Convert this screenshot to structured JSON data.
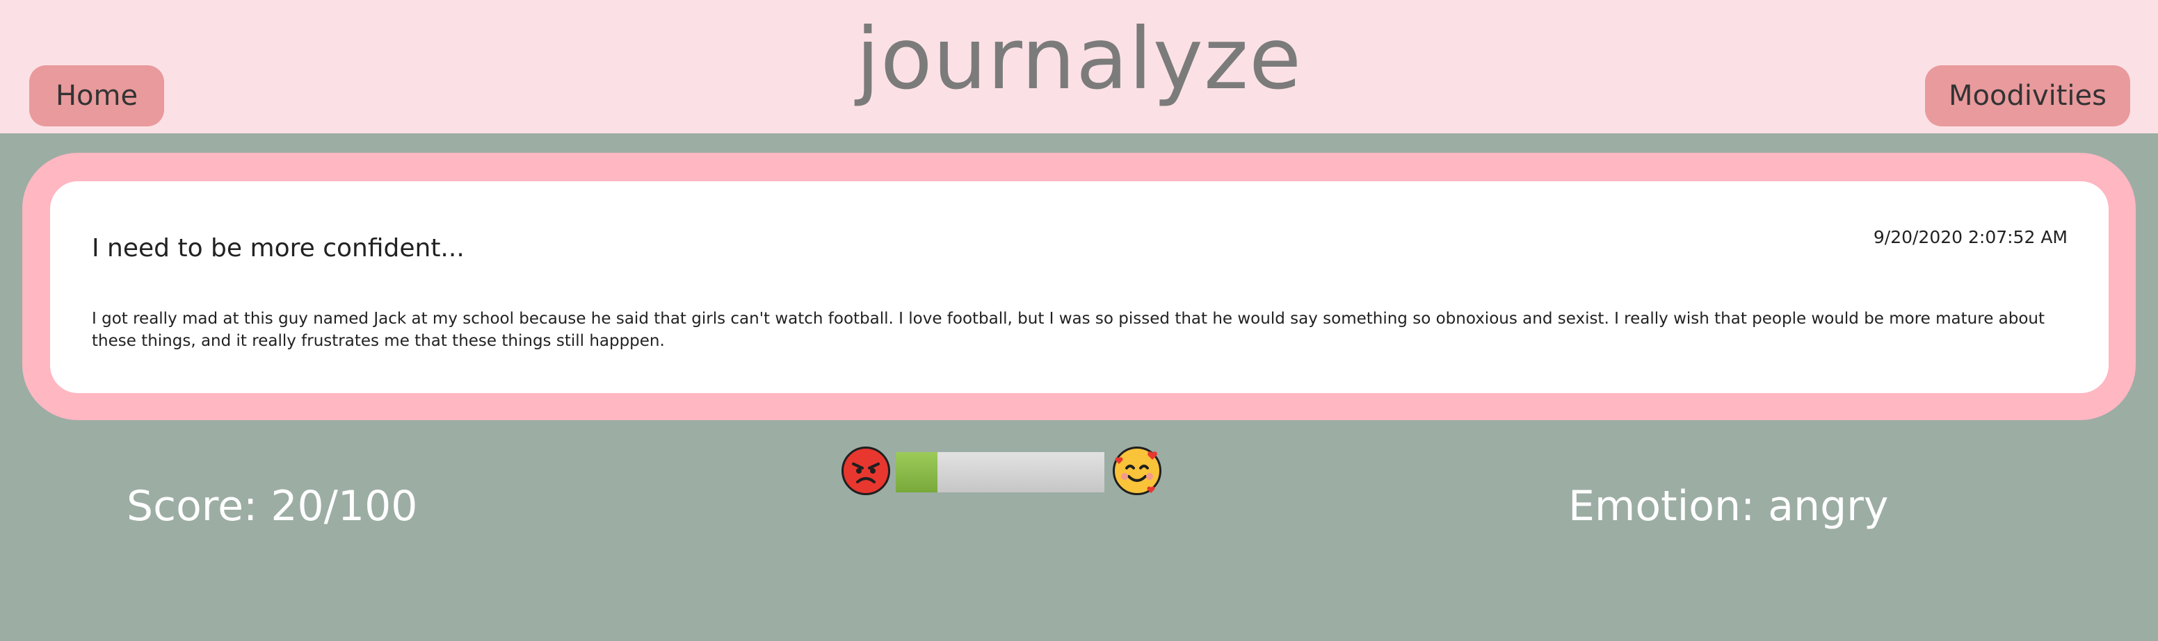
{
  "app": {
    "title": "journalyze"
  },
  "nav": {
    "home_label": "Home",
    "moodivities_label": "Moodivities"
  },
  "entry": {
    "title": "I need to be more confident...",
    "date": "9/20/2020 2:07:52 AM",
    "body": "I got really mad at this guy named Jack at my school because he said that girls can't watch football. I love football, but I was so pissed that he would say something so obnoxious and sexist. I really wish that people would be more mature about these things, and it really frustrates me that these things still happpen."
  },
  "mood": {
    "score_text": "Score: 20/100",
    "score_value": 20,
    "score_max": 100,
    "emotion_text": "Emotion: angry",
    "left_icon": "angry-face-icon",
    "right_icon": "smiling-face-with-hearts-icon"
  },
  "colors": {
    "header_bg": "#fbe1e5",
    "page_bg": "#9cada4",
    "nav_button": "#e99a9c",
    "frame": "#ffb7c2",
    "meter_fill": "#86b545"
  }
}
